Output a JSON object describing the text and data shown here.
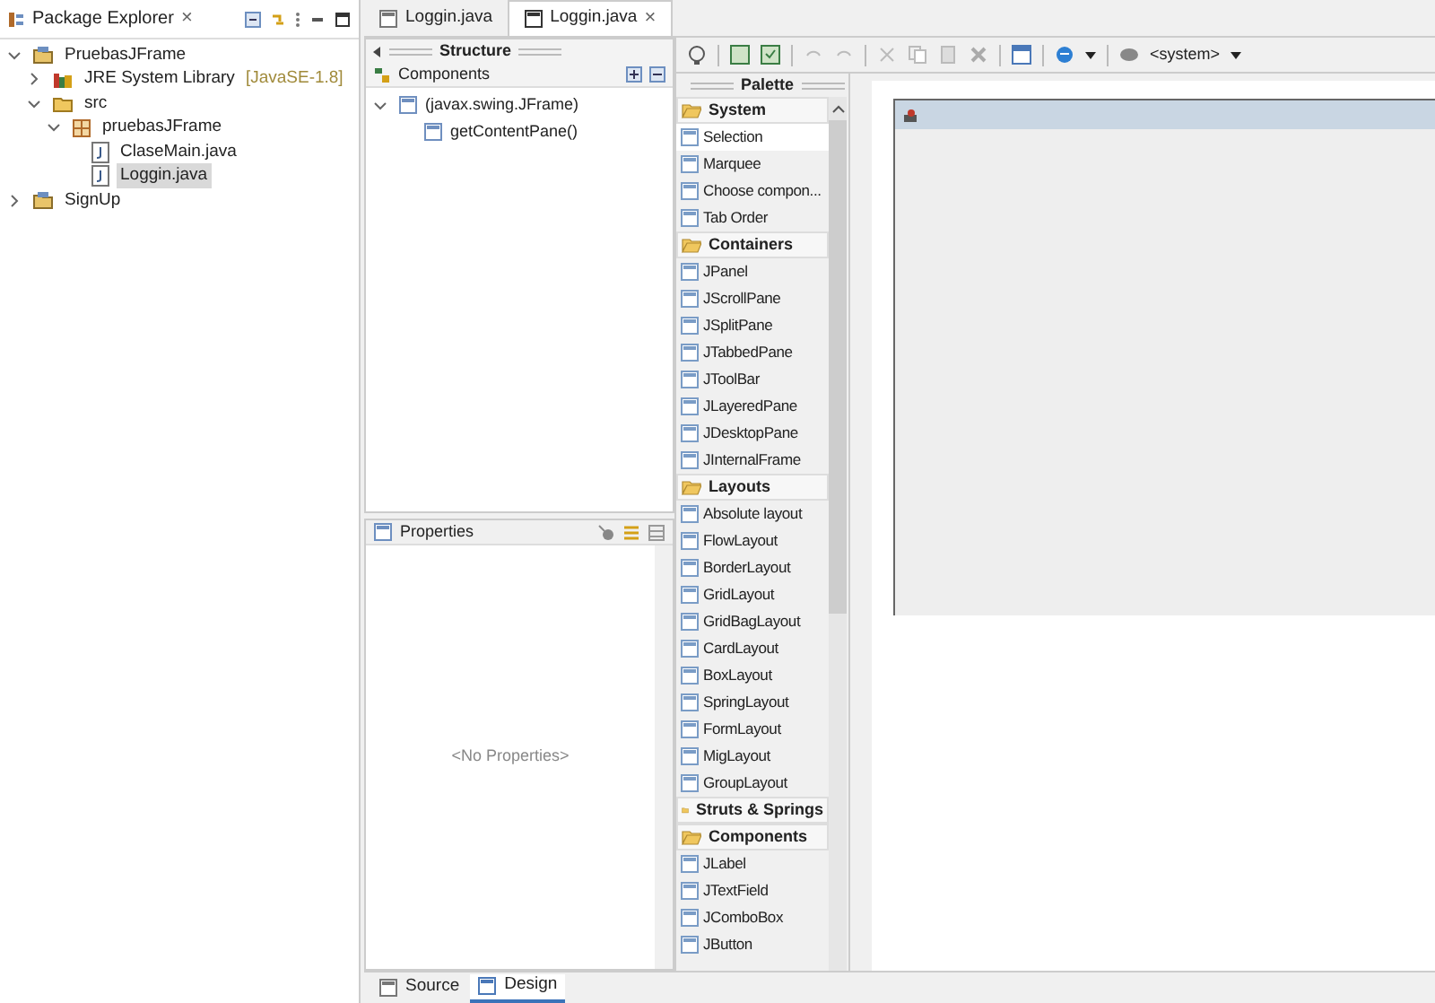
{
  "explorer": {
    "title": "Package Explorer",
    "close": "×",
    "tree": [
      {
        "label": "PruebasJFrame",
        "kind": "project",
        "expanded": true,
        "selected": false,
        "children": [
          {
            "label": "JRE System Library",
            "suffix": "[JavaSE-1.8]",
            "kind": "library",
            "expanded": false,
            "selected": false
          },
          {
            "label": "src",
            "kind": "folder",
            "expanded": true,
            "selected": false,
            "children": [
              {
                "label": "pruebasJFrame",
                "kind": "package",
                "expanded": true,
                "selected": false,
                "children": [
                  {
                    "label": "ClaseMain.java",
                    "kind": "file",
                    "selected": false
                  },
                  {
                    "label": "Loggin.java",
                    "kind": "file",
                    "selected": true
                  }
                ]
              }
            ]
          }
        ]
      },
      {
        "label": "SignUp",
        "kind": "project",
        "expanded": false,
        "selected": false
      }
    ]
  },
  "editor_tabs": [
    {
      "label": "Loggin.java",
      "selected": false
    },
    {
      "label": "Loggin.java",
      "selected": true,
      "close": "×"
    }
  ],
  "structure": {
    "title": "Structure",
    "components_label": "Components",
    "tree": [
      {
        "label": "(javax.swing.JFrame)",
        "expanded": true,
        "children": [
          {
            "label": "getContentPane()"
          }
        ]
      }
    ]
  },
  "properties": {
    "title": "Properties",
    "empty": "<No Properties>"
  },
  "toolbar": {
    "look": "<system>"
  },
  "palette": {
    "title": "Palette",
    "items": [
      {
        "kind": "category",
        "label": "System",
        "expanded": true
      },
      {
        "kind": "item",
        "label": "Selection",
        "selected": true
      },
      {
        "kind": "item",
        "label": "Marquee",
        "selected": false
      },
      {
        "kind": "item",
        "label": "Choose compon...",
        "selected": false
      },
      {
        "kind": "item",
        "label": "Tab Order",
        "selected": false
      },
      {
        "kind": "category",
        "label": "Containers",
        "expanded": true
      },
      {
        "kind": "item",
        "label": "JPanel",
        "selected": false
      },
      {
        "kind": "item",
        "label": "JScrollPane",
        "selected": false
      },
      {
        "kind": "item",
        "label": "JSplitPane",
        "selected": false
      },
      {
        "kind": "item",
        "label": "JTabbedPane",
        "selected": false
      },
      {
        "kind": "item",
        "label": "JToolBar",
        "selected": false
      },
      {
        "kind": "item",
        "label": "JLayeredPane",
        "selected": false
      },
      {
        "kind": "item",
        "label": "JDesktopPane",
        "selected": false
      },
      {
        "kind": "item",
        "label": "JInternalFrame",
        "selected": false
      },
      {
        "kind": "category",
        "label": "Layouts",
        "expanded": true
      },
      {
        "kind": "item",
        "label": "Absolute layout",
        "selected": false
      },
      {
        "kind": "item",
        "label": "FlowLayout",
        "selected": false
      },
      {
        "kind": "item",
        "label": "BorderLayout",
        "selected": false
      },
      {
        "kind": "item",
        "label": "GridLayout",
        "selected": false
      },
      {
        "kind": "item",
        "label": "GridBagLayout",
        "selected": false
      },
      {
        "kind": "item",
        "label": "CardLayout",
        "selected": false
      },
      {
        "kind": "item",
        "label": "BoxLayout",
        "selected": false
      },
      {
        "kind": "item",
        "label": "SpringLayout",
        "selected": false
      },
      {
        "kind": "item",
        "label": "FormLayout",
        "selected": false
      },
      {
        "kind": "item",
        "label": "MigLayout",
        "selected": false
      },
      {
        "kind": "item",
        "label": "GroupLayout",
        "selected": false
      },
      {
        "kind": "category",
        "label": "Struts & Springs",
        "expanded": false
      },
      {
        "kind": "category",
        "label": "Components",
        "expanded": true
      },
      {
        "kind": "item",
        "label": "JLabel",
        "selected": false
      },
      {
        "kind": "item",
        "label": "JTextField",
        "selected": false
      },
      {
        "kind": "item",
        "label": "JComboBox",
        "selected": false
      },
      {
        "kind": "item",
        "label": "JButton",
        "selected": false
      }
    ]
  },
  "bottom_tabs": [
    {
      "label": "Source",
      "selected": false
    },
    {
      "label": "Design",
      "selected": true
    }
  ]
}
